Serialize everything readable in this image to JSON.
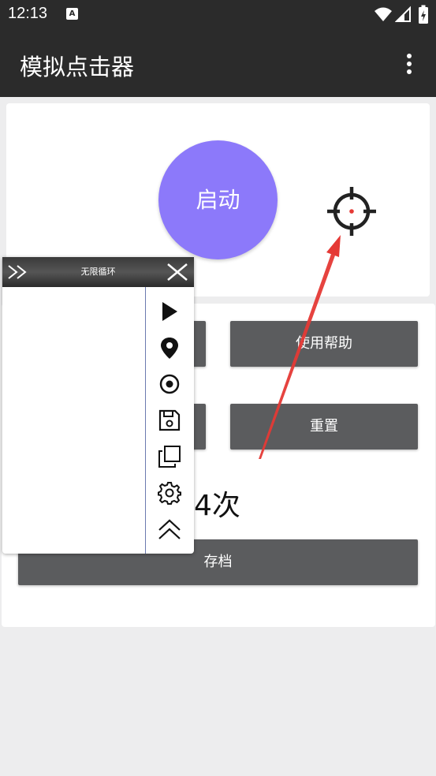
{
  "status_bar": {
    "time": "12:13",
    "a_badge": "A",
    "icons": [
      "wifi-icon",
      "signal-icon",
      "battery-charging-icon"
    ]
  },
  "app_bar": {
    "title": "模拟点击器",
    "menu_icon": "more-vert-icon"
  },
  "main": {
    "start_label": "启动",
    "target_icon": "crosshair-icon",
    "help_label": "使用帮助",
    "reset_label": "重置",
    "count_text": "4次",
    "save_label": "存档"
  },
  "float_panel": {
    "title": "无限循环",
    "tools": [
      "play-icon",
      "location-pin-icon",
      "radio-target-icon",
      "save-icon",
      "copy-icon",
      "gear-icon",
      "collapse-up-icon"
    ]
  },
  "colors": {
    "bar": "#2b2b2b",
    "accent": "#8c79fa",
    "button": "#5b5c5e",
    "arrow": "#e53935"
  }
}
